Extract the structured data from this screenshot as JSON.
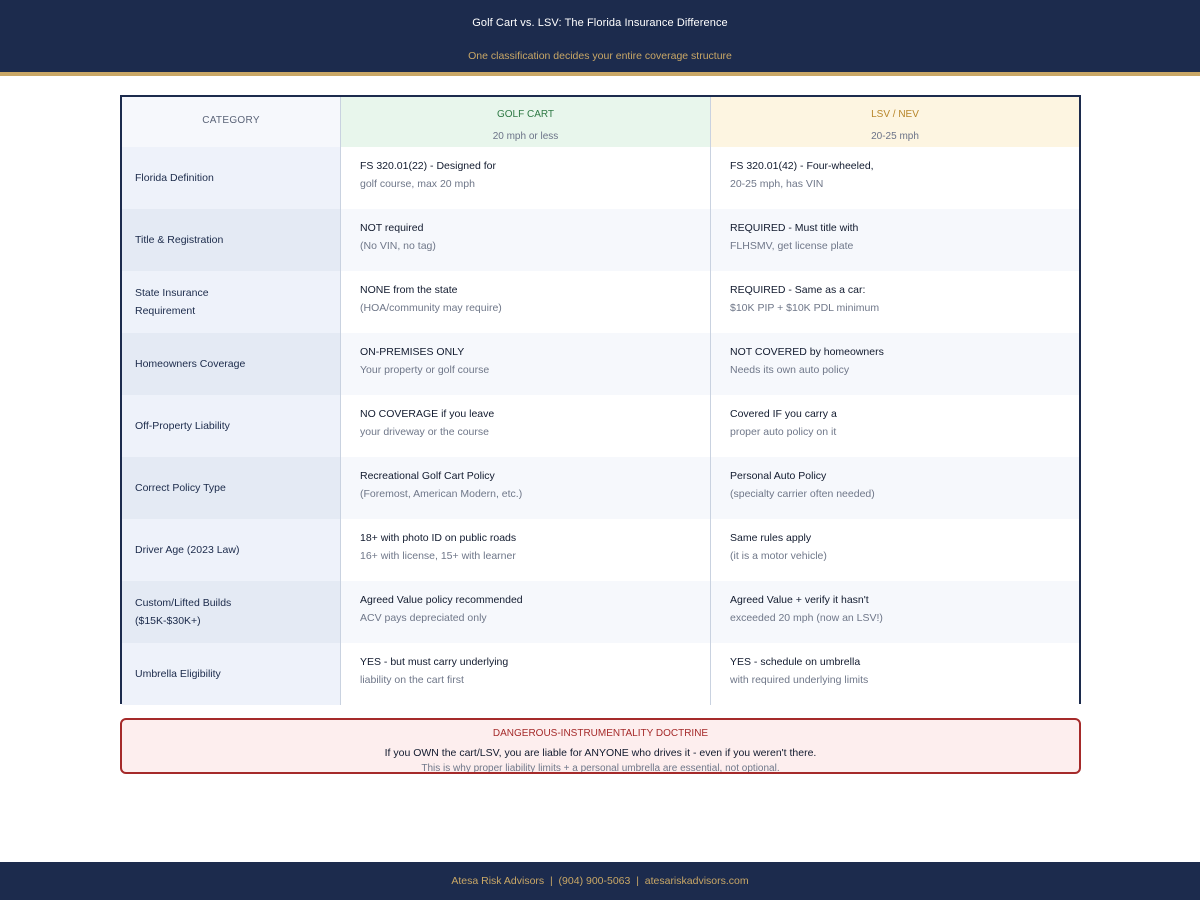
{
  "header": {
    "title": "Golf Cart vs. LSV: The Florida Insurance Difference",
    "subtitle": "One classification decides your entire coverage structure"
  },
  "table": {
    "columns": {
      "category": {
        "title": "CATEGORY"
      },
      "golf": {
        "title": "GOLF CART",
        "subtitle": "20 mph or less"
      },
      "lsv": {
        "title": "LSV / NEV",
        "subtitle": "20-25 mph"
      }
    },
    "rows": [
      {
        "category": "Florida Definition",
        "golf": {
          "primary": "FS 320.01(22) - Designed for",
          "secondary": "golf course, max 20 mph"
        },
        "lsv": {
          "primary": "FS 320.01(42) - Four-wheeled,",
          "secondary": "20-25 mph, has VIN"
        }
      },
      {
        "category": "Title & Registration",
        "golf": {
          "primary": "NOT required",
          "secondary": "(No VIN, no tag)"
        },
        "lsv": {
          "primary": "REQUIRED - Must title with",
          "secondary": "FLHSMV, get license plate"
        }
      },
      {
        "category": "State Insurance Requirement",
        "golf": {
          "primary": "NONE from the state",
          "secondary": "(HOA/community may require)"
        },
        "lsv": {
          "primary": "REQUIRED - Same as a car:",
          "secondary": "$10K PIP + $10K PDL minimum"
        }
      },
      {
        "category": "Homeowners Coverage",
        "golf": {
          "primary": "ON-PREMISES ONLY",
          "secondary": "Your property or golf course"
        },
        "lsv": {
          "primary": "NOT COVERED by homeowners",
          "secondary": "Needs its own auto policy"
        }
      },
      {
        "category": "Off-Property Liability",
        "golf": {
          "primary": "NO COVERAGE if you leave",
          "secondary": "your driveway or the course"
        },
        "lsv": {
          "primary": "Covered IF you carry a",
          "secondary": "proper auto policy on it"
        }
      },
      {
        "category": "Correct Policy Type",
        "golf": {
          "primary": "Recreational Golf Cart Policy",
          "secondary": "(Foremost, American Modern, etc.)"
        },
        "lsv": {
          "primary": "Personal Auto Policy",
          "secondary": "(specialty carrier often needed)"
        }
      },
      {
        "category": "Driver Age (2023 Law)",
        "golf": {
          "primary": "18+ with photo ID on public roads",
          "secondary": "16+ with license, 15+ with learner"
        },
        "lsv": {
          "primary": "Same rules apply",
          "secondary": "(it is a motor vehicle)"
        }
      },
      {
        "category": "Custom/Lifted Builds ($15K-$30K+)",
        "golf": {
          "primary": "Agreed Value policy recommended",
          "secondary": "ACV pays depreciated only"
        },
        "lsv": {
          "primary": "Agreed Value + verify it hasn't",
          "secondary": "exceeded 20 mph (now an LSV!)"
        }
      },
      {
        "category": "Umbrella Eligibility",
        "golf": {
          "primary": "YES - but must carry underlying",
          "secondary": "liability on the cart first"
        },
        "lsv": {
          "primary": "YES - schedule on umbrella",
          "secondary": "with required underlying limits"
        }
      }
    ]
  },
  "warning": {
    "title": "DANGEROUS-INSTRUMENTALITY DOCTRINE",
    "line1": "If you OWN the cart/LSV, you are liable for ANYONE who drives it - even if you weren't there.",
    "line2": "This is why proper liability limits + a personal umbrella are essential, not optional."
  },
  "footer": {
    "text": "Atesa Risk Advisors  |  (904) 900-5063  |  atesariskadvisors.com"
  }
}
